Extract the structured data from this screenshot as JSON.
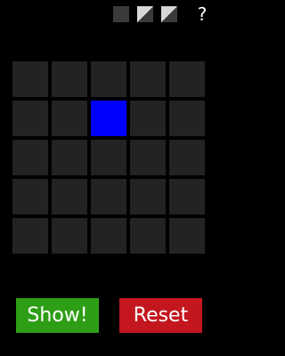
{
  "toolbar": {
    "icons": [
      "square-icon",
      "half-shaded-square-icon",
      "half-shaded-square-icon",
      "help-icon"
    ],
    "help_label": "?"
  },
  "grid": {
    "rows": 5,
    "cols": 5,
    "active_cells": [
      [
        1,
        2
      ]
    ],
    "colors": {
      "cell": "#232323",
      "active": "#0000ff"
    }
  },
  "buttons": {
    "show_label": "Show!",
    "reset_label": "Reset",
    "colors": {
      "show": "#2f9e17",
      "reset": "#c4161f"
    }
  }
}
